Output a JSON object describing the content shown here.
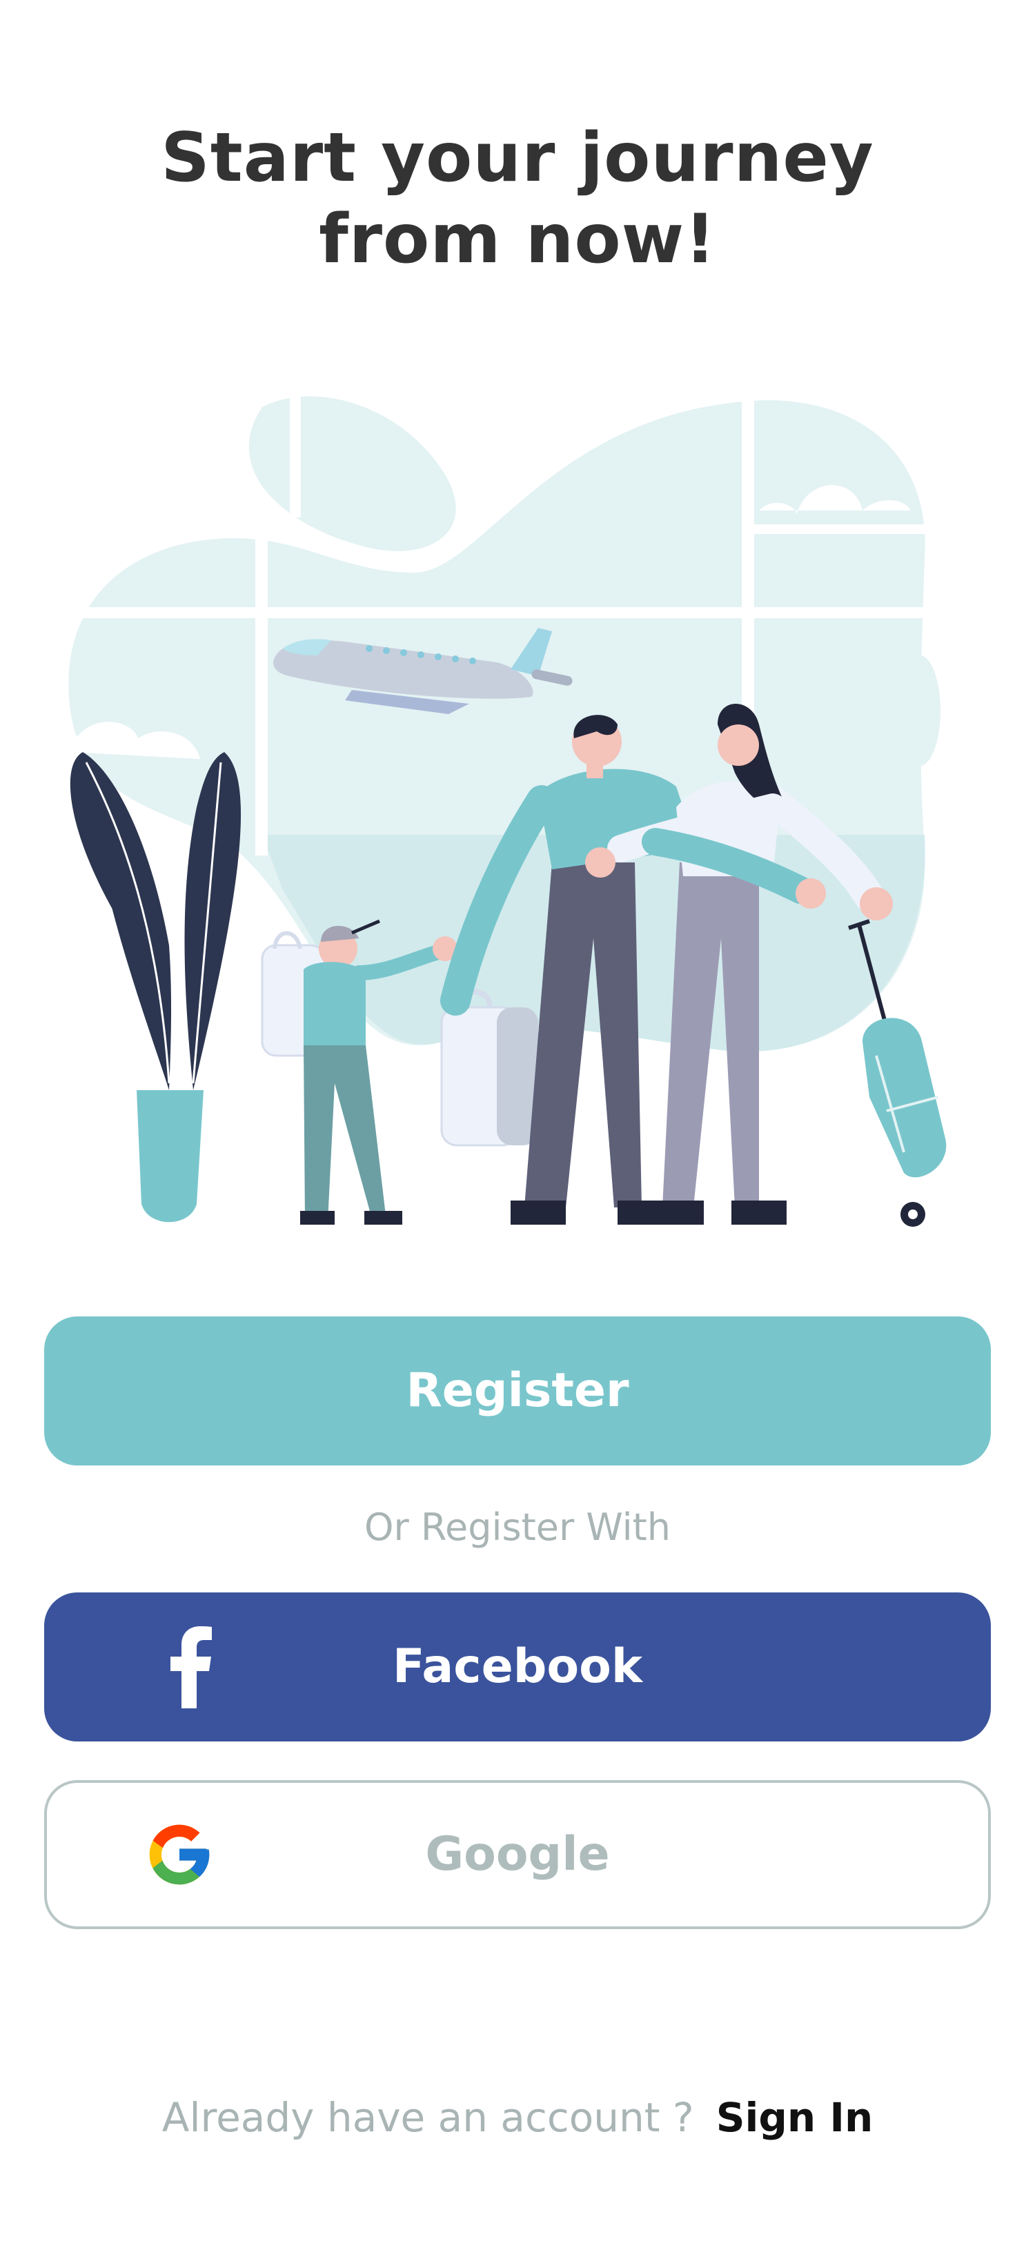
{
  "header": {
    "title_line1": "Start your journey",
    "title_line2": "from now!"
  },
  "illustration": {
    "icon": "travelers-at-airport-illustration"
  },
  "actions": {
    "register_label": "Register",
    "or_text": "Or Register With",
    "facebook_label": "Facebook",
    "facebook_icon": "facebook-icon",
    "google_label": "Google",
    "google_icon": "google-icon"
  },
  "footer": {
    "prompt": "Already have an account ?",
    "sign_in_label": "Sign In"
  },
  "colors": {
    "accent": "#78c6cc",
    "facebook": "#3a539c",
    "title": "#333333",
    "muted": "#a9b4b4"
  }
}
